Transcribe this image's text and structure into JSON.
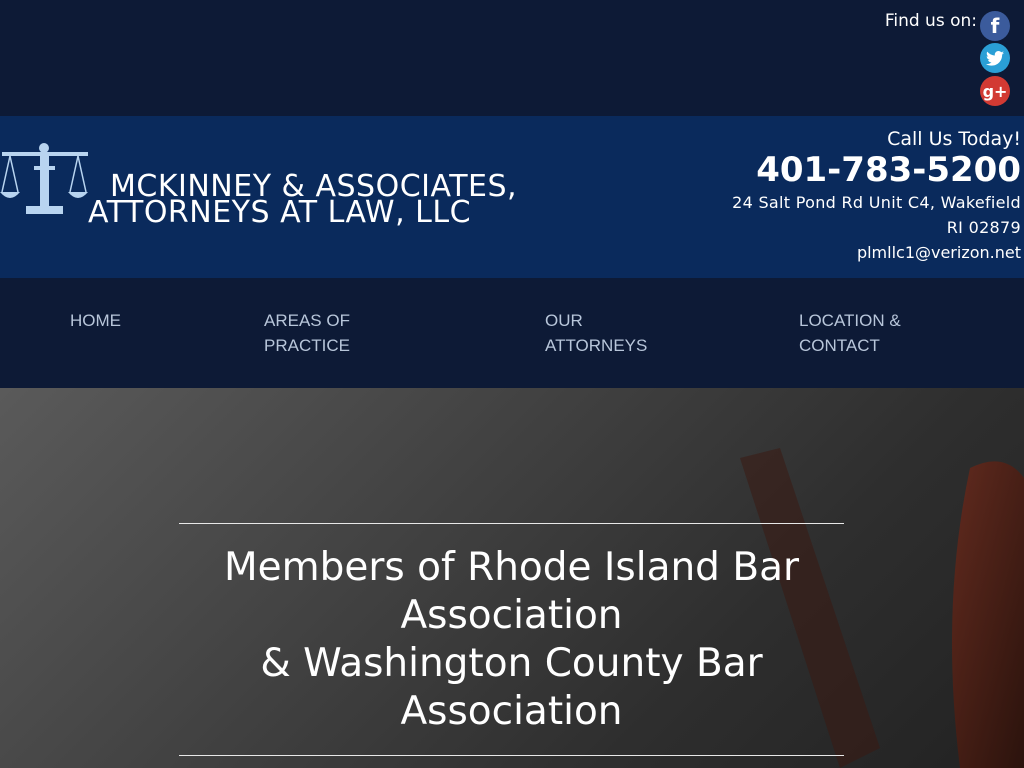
{
  "topbar": {
    "find_us": "Find us on:",
    "social": [
      {
        "name": "facebook-icon",
        "glyph": "f"
      },
      {
        "name": "twitter-icon",
        "glyph": "t"
      },
      {
        "name": "google-plus-icon",
        "glyph": "g+"
      }
    ]
  },
  "header": {
    "firm_line1": "MCKINNEY & ASSOCIATES,",
    "firm_line2": "ATTORNEYS AT LAW, LLC",
    "call_us": "Call Us Today!",
    "phone": "401-783-5200",
    "address_line1": "24 Salt Pond Rd Unit C4, Wakefield",
    "address_line2": "RI 02879",
    "email": "plmllc1@verizon.net"
  },
  "nav": {
    "home": "HOME",
    "areas_line1": "AREAS OF",
    "areas_line2": "PRACTICE",
    "attorneys_line1": "OUR",
    "attorneys_line2": "ATTORNEYS",
    "location_line1": "LOCATION &",
    "location_line2": "CONTACT"
  },
  "hero": {
    "line1": "Members of Rhode Island Bar",
    "line2": "Association",
    "line3": "& Washington County Bar",
    "line4": "Association"
  },
  "colors": {
    "topbar_bg": "#0d1a36",
    "header_bg": "#0a2a5c",
    "nav_text": "#b8c6da",
    "logo": "#b8d4f0",
    "facebook": "#3b5b9c",
    "twitter": "#2a9fd6",
    "google_plus": "#d23a33"
  }
}
